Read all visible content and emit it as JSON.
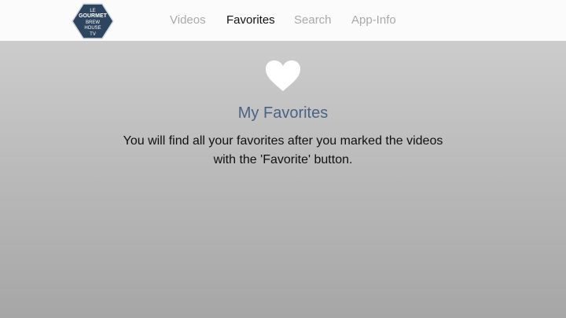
{
  "logo": {
    "line1": "LE",
    "line2": "GOURMET",
    "line3": "BREW",
    "line4": "HOUSE",
    "line5": "TV"
  },
  "nav": {
    "items": [
      {
        "label": "Videos"
      },
      {
        "label": "Favorites"
      },
      {
        "label": "Search"
      },
      {
        "label": "App-Info"
      }
    ],
    "active": "Favorites"
  },
  "main": {
    "icon": "heart-icon",
    "title": "My Favorites",
    "message_line1": "You will find all your favorites after you marked the videos",
    "message_line2": "with the 'Favorite' button."
  },
  "colors": {
    "title": "#4a6383",
    "logo_bg": "#2e4560",
    "nav_inactive": "#a9a9a9",
    "nav_active": "#111111"
  }
}
